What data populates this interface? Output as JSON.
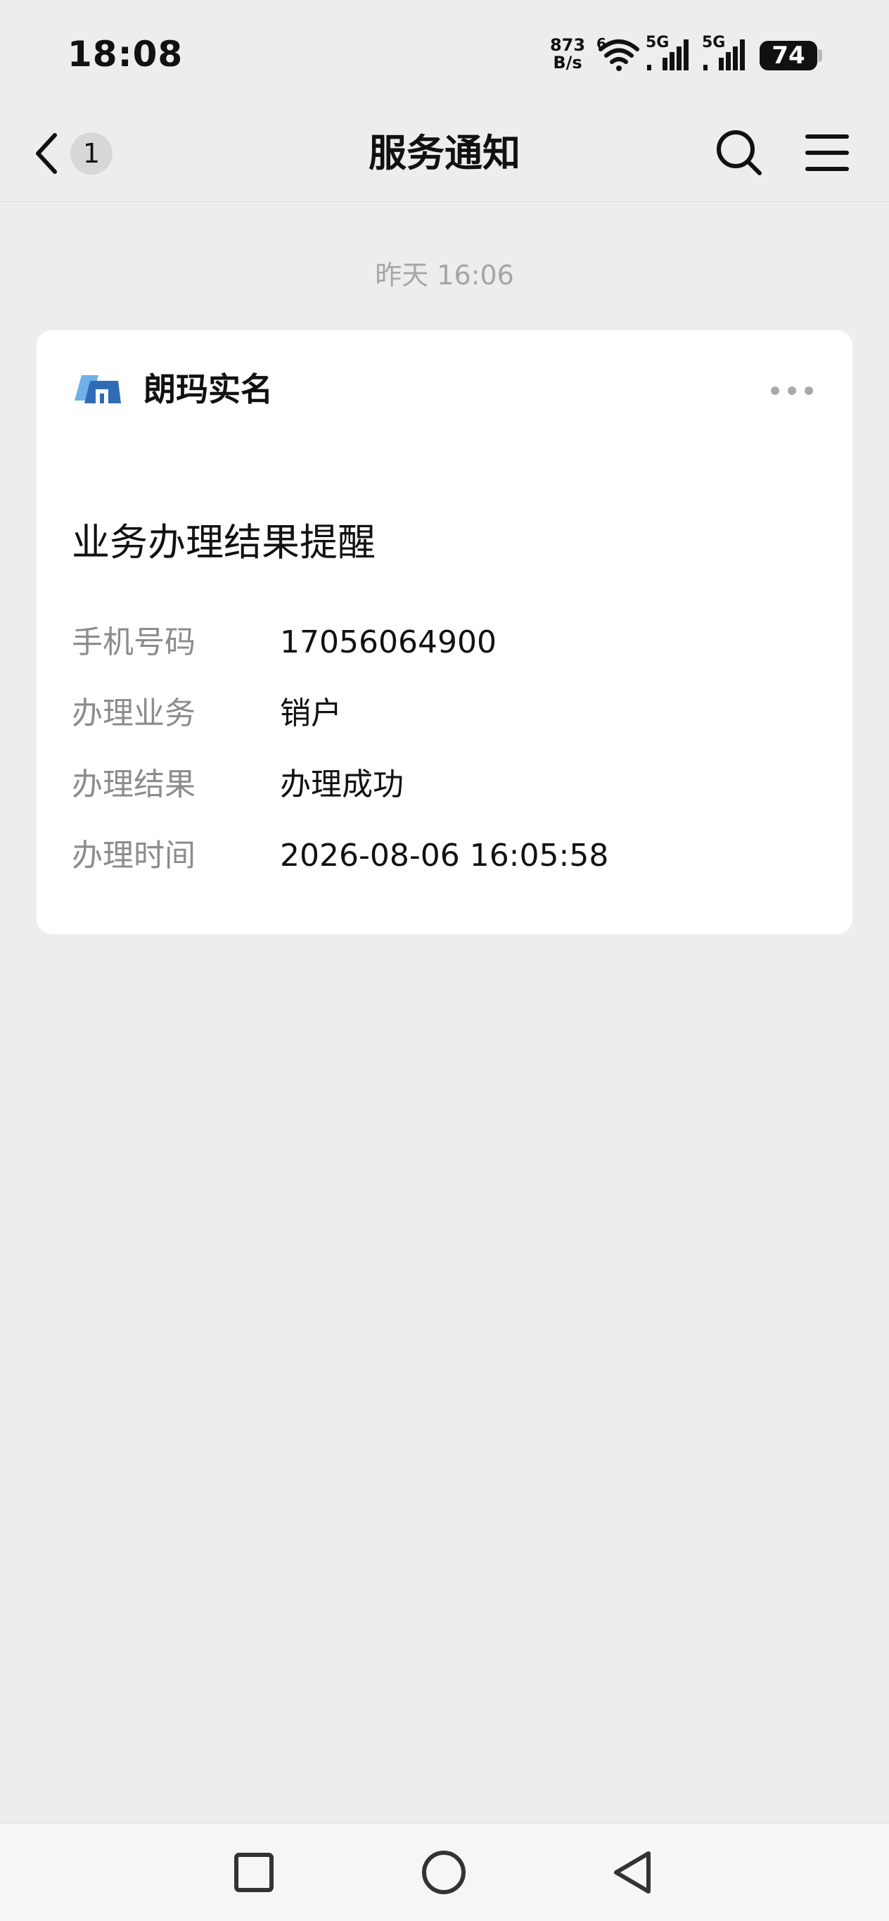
{
  "status_bar": {
    "time": "18:08",
    "net_speed_value": "873",
    "net_speed_unit": "B/s",
    "wifi_tag": "6",
    "sim1_label": "5G",
    "sim2_label": "5G",
    "battery": "74"
  },
  "nav": {
    "unread_count": "1",
    "title": "服务通知",
    "icons": [
      "back-icon",
      "search-icon",
      "menu-icon"
    ]
  },
  "timestamp": "昨天 16:06",
  "card": {
    "brand_name": "朗玛实名",
    "title": "业务办理结果提醒",
    "rows": [
      {
        "label": "手机号码",
        "value": "17056064900"
      },
      {
        "label": "办理业务",
        "value": "销户"
      },
      {
        "label": "办理结果",
        "value": "办理成功"
      },
      {
        "label": "办理时间",
        "value": "2026-08-06 16:05:58"
      }
    ]
  },
  "system_nav": {
    "icons": [
      "square-icon",
      "circle-icon",
      "triangle-back-icon"
    ]
  },
  "colors": {
    "background": "#ededed",
    "card": "#ffffff",
    "label_gray": "#8c8c8c",
    "logo_blue": "#2f6cb5",
    "logo_light": "#6fb0e8"
  }
}
